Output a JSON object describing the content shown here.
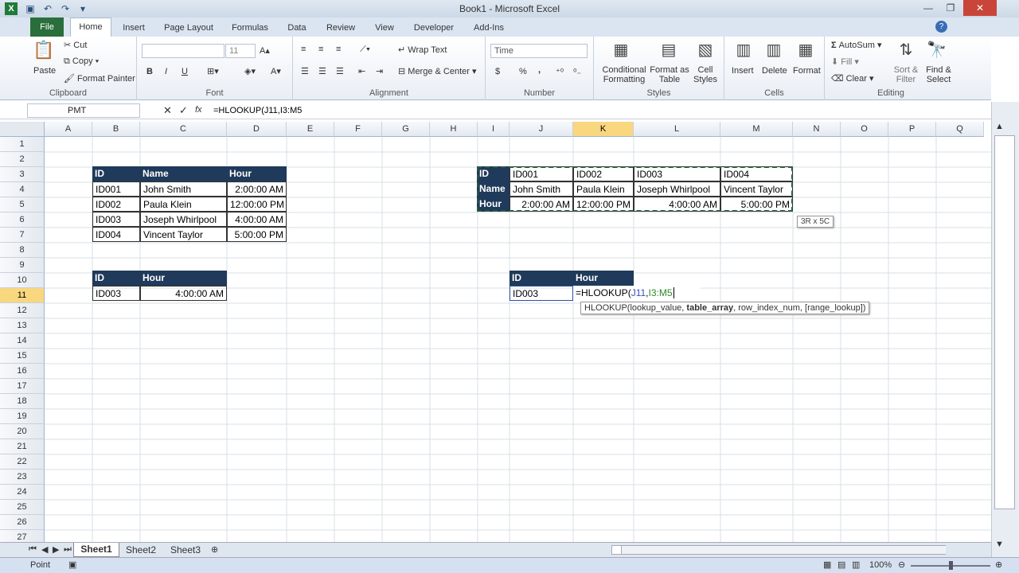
{
  "app": {
    "title": "Book1 - Microsoft Excel",
    "logo_letter": "X"
  },
  "tabs": [
    "File",
    "Home",
    "Insert",
    "Page Layout",
    "Formulas",
    "Data",
    "Review",
    "View",
    "Developer",
    "Add-Ins"
  ],
  "ribbon": {
    "clipboard": {
      "label": "Clipboard",
      "paste": "Paste",
      "cut": "Cut",
      "copy": "Copy",
      "format_painter": "Format Painter"
    },
    "font": {
      "label": "Font",
      "font_name": "",
      "font_size": "11",
      "bold": "B",
      "italic": "I",
      "underline": "U"
    },
    "alignment": {
      "label": "Alignment",
      "wrap": "Wrap Text",
      "merge": "Merge & Center"
    },
    "number": {
      "label": "Number",
      "format": "Time",
      "currency": "$",
      "percent": "%",
      "comma": ","
    },
    "styles": {
      "label": "Styles",
      "conditional": "Conditional Formatting",
      "format_table": "Format as Table",
      "cell_styles": "Cell Styles"
    },
    "cells": {
      "label": "Cells",
      "insert": "Insert",
      "delete": "Delete",
      "format": "Format"
    },
    "editing": {
      "label": "Editing",
      "autosum": "AutoSum",
      "fill": "Fill",
      "clear": "Clear",
      "sort": "Sort & Filter",
      "find": "Find & Select"
    }
  },
  "formula_bar": {
    "name_box": "PMT",
    "fx": "fx",
    "formula": "=HLOOKUP(J11,I3:M5"
  },
  "columns": [
    "A",
    "B",
    "C",
    "D",
    "E",
    "F",
    "G",
    "H",
    "I",
    "J",
    "K",
    "L",
    "M",
    "N",
    "O",
    "P",
    "Q"
  ],
  "rows": [
    "1",
    "2",
    "3",
    "4",
    "5",
    "6",
    "7",
    "8",
    "9",
    "10",
    "11",
    "12",
    "13",
    "14",
    "15",
    "16",
    "17",
    "18",
    "19",
    "20",
    "21",
    "22",
    "23",
    "24",
    "25",
    "26",
    "27"
  ],
  "table1": {
    "headers": [
      "ID",
      "Name",
      "Hour"
    ],
    "rows": [
      [
        "ID001",
        "John Smith",
        "2:00:00 AM"
      ],
      [
        "ID002",
        "Paula Klein",
        "12:00:00 PM"
      ],
      [
        "ID003",
        "Joseph Whirlpool",
        "4:00:00 AM"
      ],
      [
        "ID004",
        "Vincent Taylor",
        "5:00:00 PM"
      ]
    ]
  },
  "lookup1": {
    "headers": [
      "ID",
      "Hour"
    ],
    "id": "ID003",
    "hour": "4:00:00 AM"
  },
  "table2": {
    "row_headers": [
      "ID",
      "Name",
      "Hour"
    ],
    "ids": [
      "ID001",
      "ID002",
      "ID003",
      "ID004"
    ],
    "names": [
      "John Smith",
      "Paula Klein",
      "Joseph Whirlpool",
      "Vincent Taylor"
    ],
    "hours": [
      "2:00:00 AM",
      "12:00:00 PM",
      "4:00:00 AM",
      "5:00:00 PM"
    ]
  },
  "lookup2": {
    "headers": [
      "ID",
      "Hour"
    ],
    "id": "ID003",
    "formula_prefix": "=HLOOKUP(",
    "formula_arg1": "J11",
    "formula_sep": ",",
    "formula_arg2": "I3:M5"
  },
  "range_tooltip": "3R x 5C",
  "func_tooltip": {
    "name": "HLOOKUP(",
    "arg1": "lookup_value, ",
    "arg2": "table_array",
    "rest": ", row_index_num, [range_lookup])"
  },
  "sheets": [
    "Sheet1",
    "Sheet2",
    "Sheet3"
  ],
  "status": {
    "mode": "Point",
    "zoom": "100%"
  },
  "colors": {
    "header_fill": "#1f3a5a",
    "accent": "#2a6e3b",
    "selection": "#f9d77e"
  }
}
